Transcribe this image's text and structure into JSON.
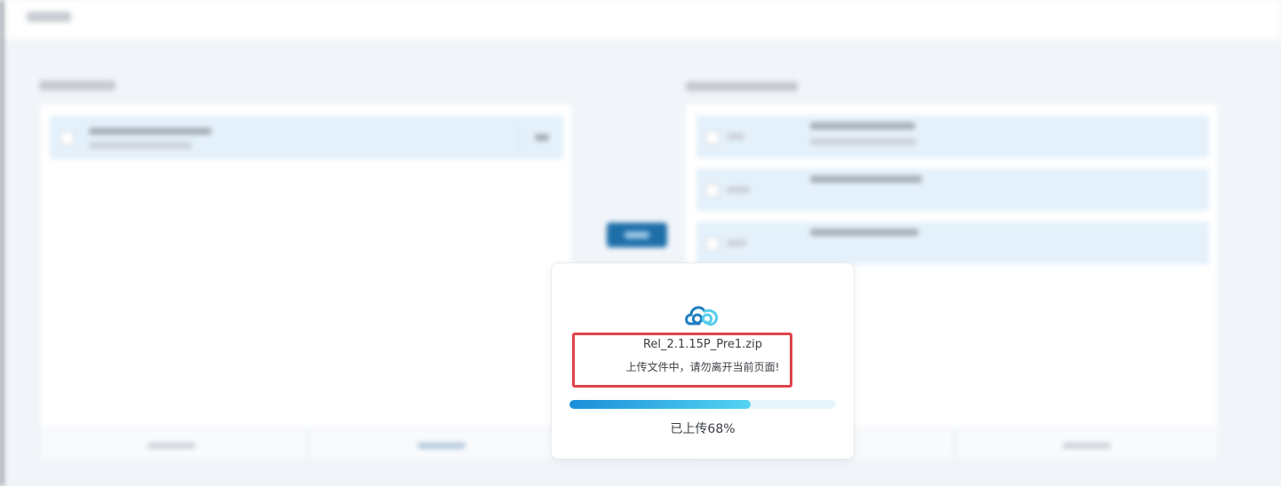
{
  "upload_dialog": {
    "file_name": "Rel_2.1.15P_Pre1.zip",
    "message": "上传文件中，请勿离开当前页面!",
    "progress_percent": 68,
    "progress_label": "已上传68%",
    "icon": "cloud-icon"
  },
  "colors": {
    "progress_start": "#1a8fd8",
    "progress_end": "#56d3f3",
    "highlight_border": "#e0434a",
    "transfer_button": "#1d6fa8"
  }
}
